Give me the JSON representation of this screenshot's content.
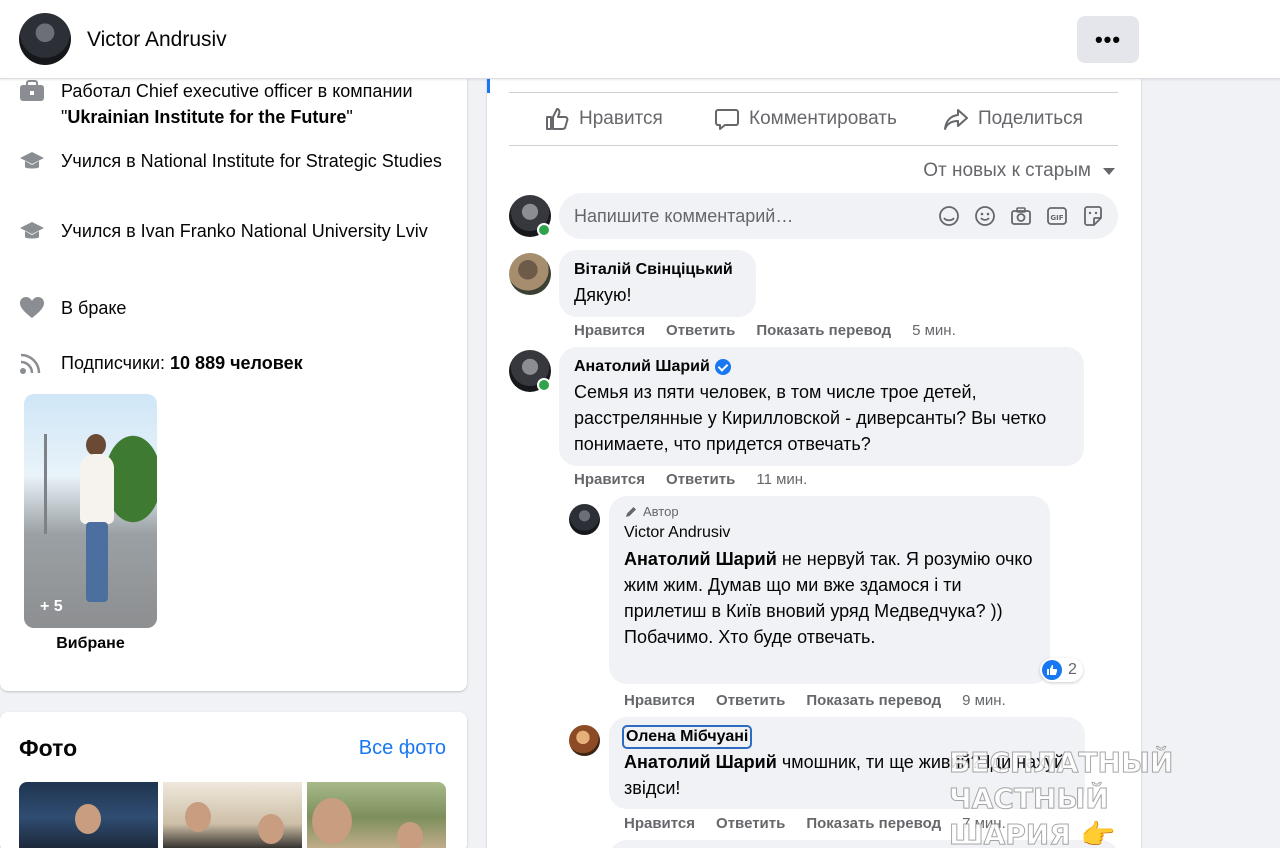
{
  "header": {
    "profile_name": "Victor Andrusiv",
    "more_label": "•••"
  },
  "intro": {
    "work_prefix": "Работал Chief executive officer в компании \"",
    "work_company": "Ukrainian Institute for the Future",
    "work_suffix": "\"",
    "edu1": "Учился в National Institute for Strategic Studies",
    "edu2": "Учился в Ivan Franko National University Lviv",
    "relationship": "В браке",
    "followers_prefix": "Подписчики: ",
    "followers_count": "10 889 человек",
    "featured_more": "+ 5",
    "featured_label": "Вибране"
  },
  "photos": {
    "title": "Фото",
    "all_link": "Все фото"
  },
  "post_actions": {
    "like": "Нравится",
    "comment": "Комментировать",
    "share": "Поделиться"
  },
  "sort": {
    "label": "От новых к старым"
  },
  "composer": {
    "placeholder": "Напишите комментарий…"
  },
  "comments": [
    {
      "author": "Віталій Свінціцький",
      "text": "Дякую!",
      "actions": [
        "Нравится",
        "Ответить",
        "Показать перевод"
      ],
      "time": "5 мин."
    },
    {
      "author": "Анатолий Шарий",
      "text": "Семья из пяти человек, в том числе трое детей, расстрелянные у Кирилловской - диверсанты? Вы четко понимаете, что придется отвечать?",
      "actions": [
        "Нравится",
        "Ответить"
      ],
      "time": "11 мин."
    },
    {
      "badge": "Автор",
      "author": "Victor Andrusiv",
      "mention": "Анатолий Шарий",
      "text": " не нервуй так. Я розумію очко жим жим. Думав що ми вже здамося і ти прилетиш в Київ вновий уряд Медведчука? ))",
      "text2": "Побачимо. Хто буде отвечать.",
      "reactions": "2",
      "actions": [
        "Нравится",
        "Ответить",
        "Показать перевод"
      ],
      "time": "9 мин."
    },
    {
      "author": "Олена Мібчуані",
      "mention": "Анатолий Шарий",
      "text": " чмошник, ти ще живий? Іди нахуй звідси!",
      "actions": [
        "Нравится",
        "Ответить",
        "Показать перевод"
      ],
      "time": "7 мин."
    }
  ],
  "watermark": {
    "line1": "БЕСПЛАТНЫЙ ЧАСТНЫЙ",
    "line2": "ШАРИЯ 👉 Sharij.net"
  }
}
